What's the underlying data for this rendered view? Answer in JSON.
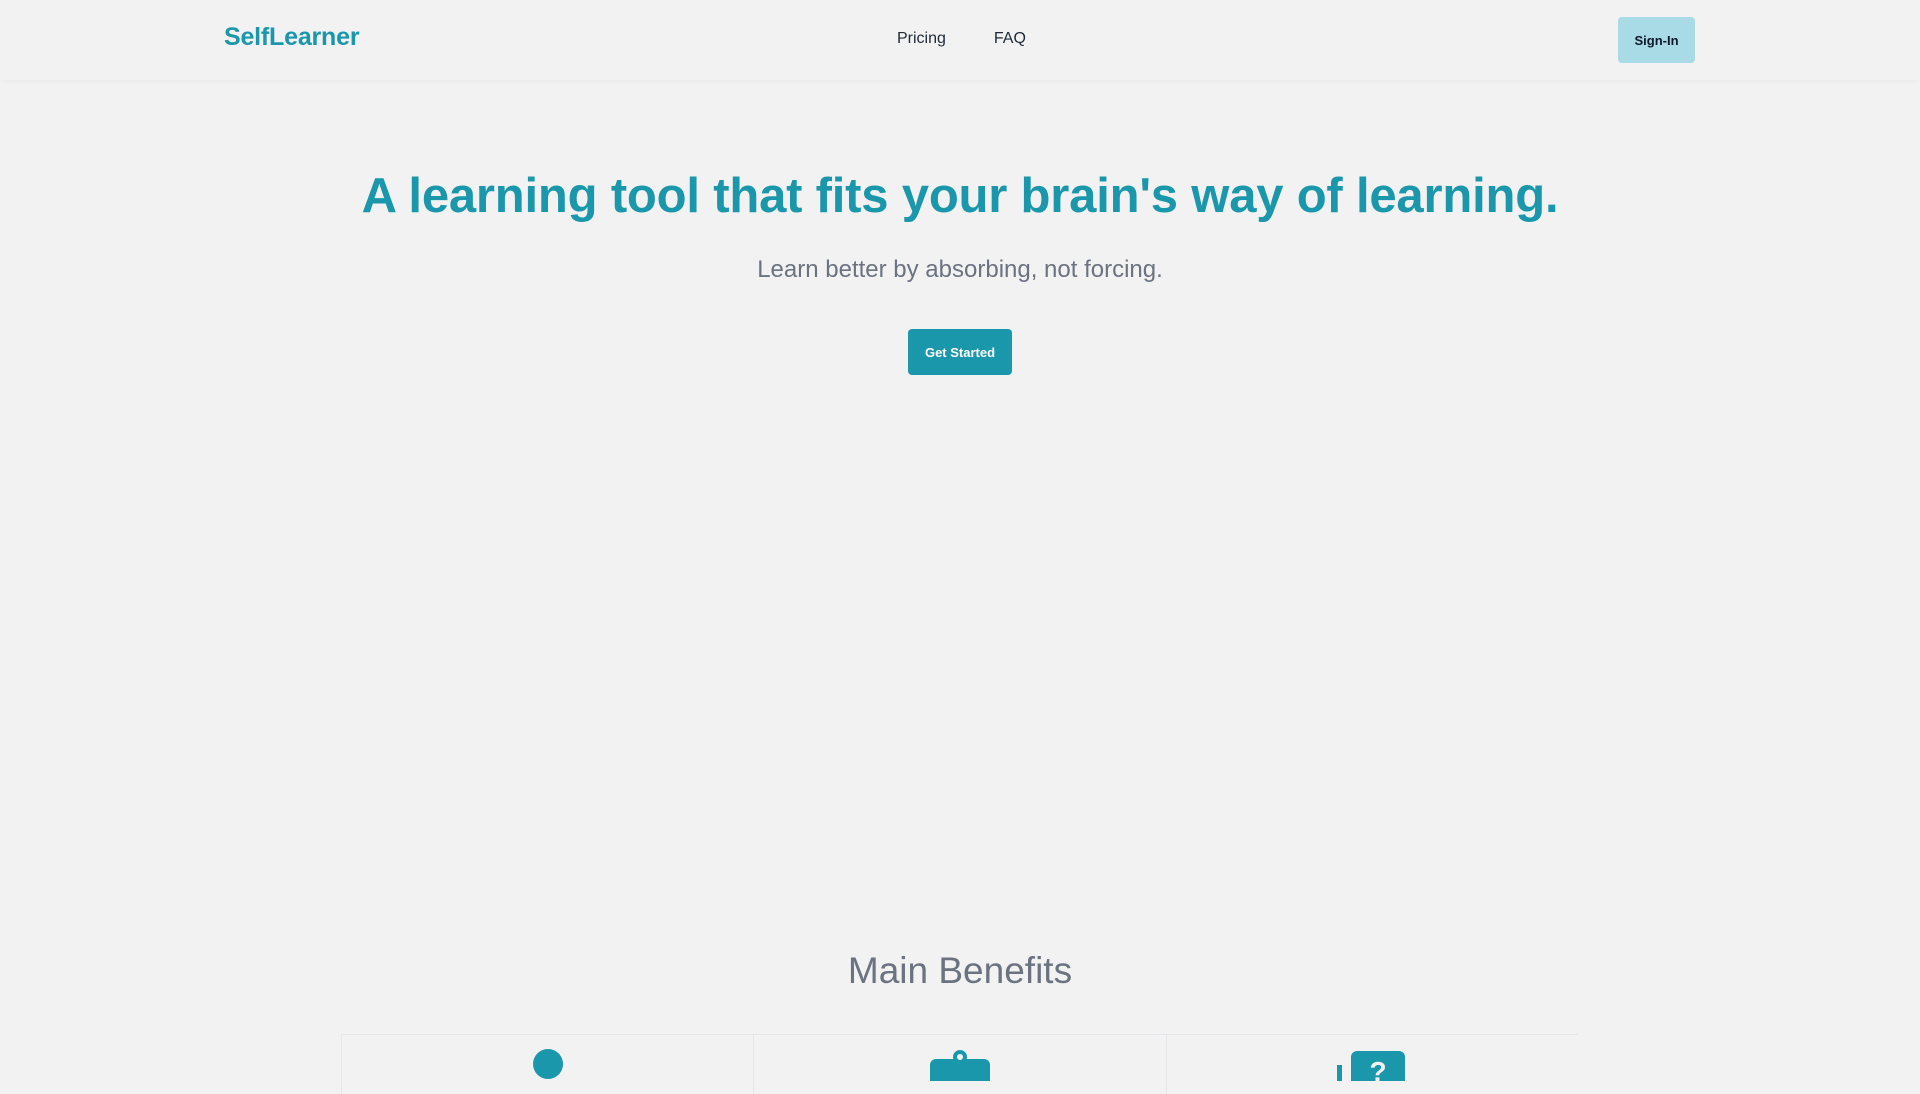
{
  "nav": {
    "brand": "SelfLearner",
    "links": [
      "Pricing",
      "FAQ"
    ],
    "signin_label": "Sign-In"
  },
  "hero": {
    "title": "A learning tool that fits your brain's way of learning.",
    "subtitle": "Learn better by absorbing, not forcing.",
    "cta_label": "Get Started"
  },
  "benefits": {
    "title": "Main Benefits",
    "cards": [
      {
        "icon": "person-icon"
      },
      {
        "icon": "clipboard-icon"
      },
      {
        "icon": "question-icon"
      }
    ]
  },
  "colors": {
    "accent": "#1a97ab",
    "signin_bg": "#a8dbe5",
    "background": "#f2f2f2"
  }
}
